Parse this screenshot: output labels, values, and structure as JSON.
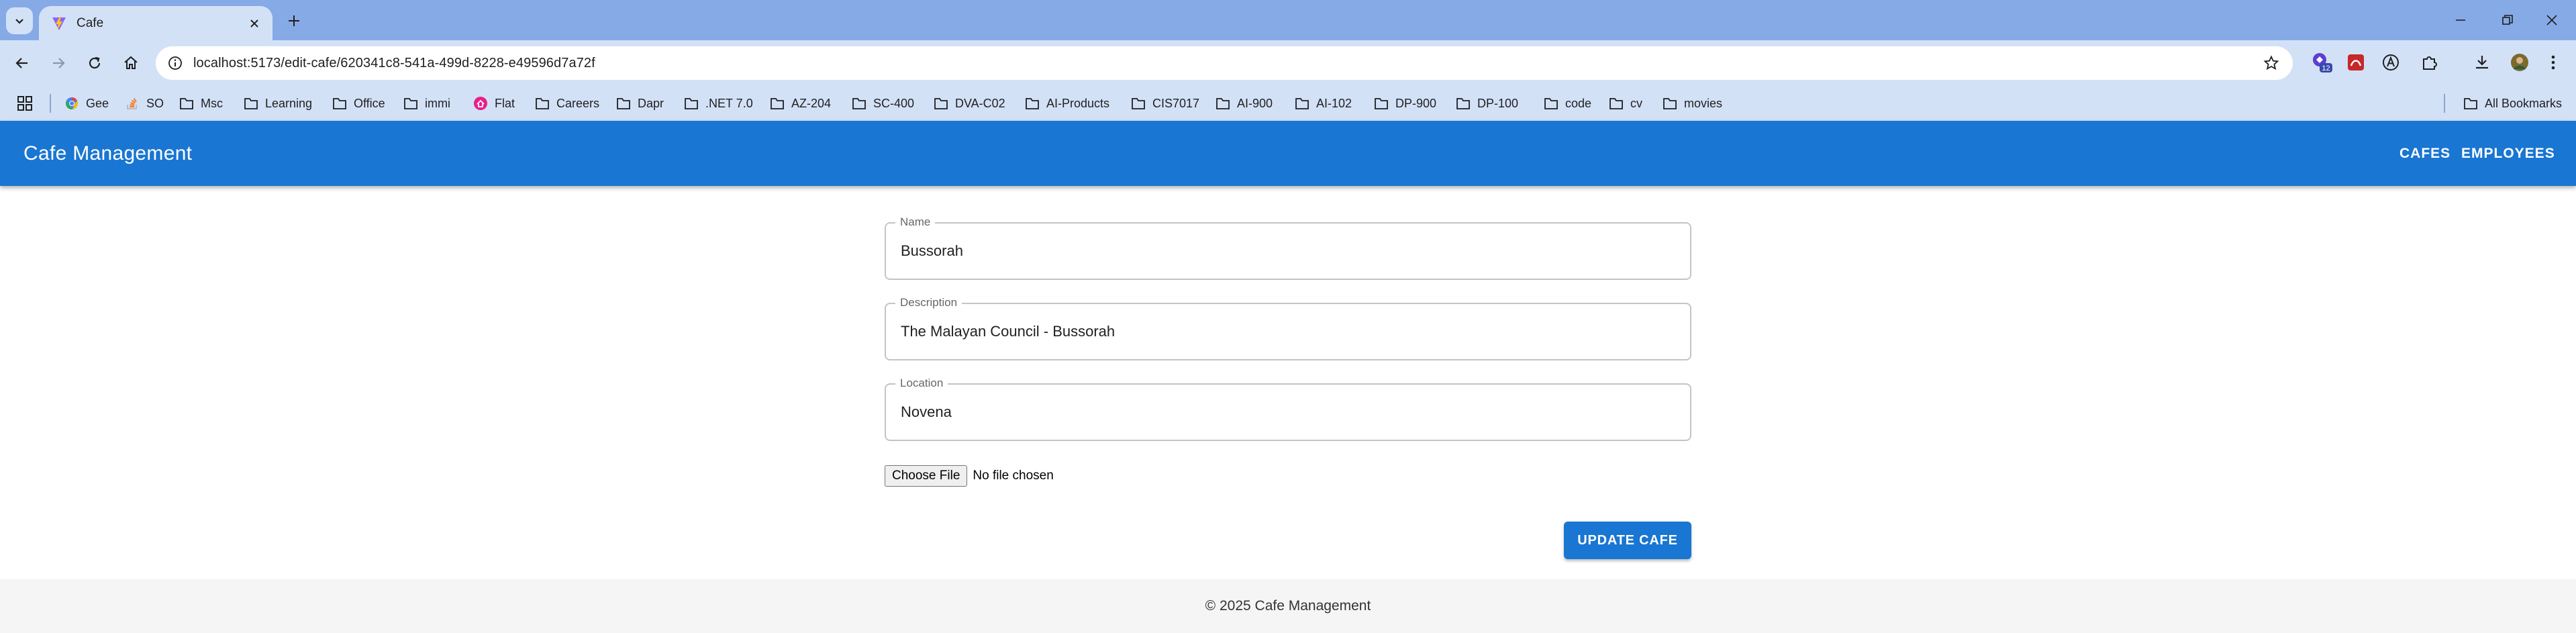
{
  "browser": {
    "tab_title": "Cafe",
    "url": "localhost:5173/edit-cafe/620341c8-541a-499d-8228-e49596d7a72f",
    "extension_badge": "12",
    "bookmarks": [
      {
        "label": "Gee",
        "icon": "chrome-icon"
      },
      {
        "label": "SO",
        "icon": "stackoverflow-icon"
      },
      {
        "label": "Msc",
        "icon": "folder-icon"
      },
      {
        "label": "Learning",
        "icon": "folder-icon"
      },
      {
        "label": "Office",
        "icon": "folder-icon"
      },
      {
        "label": "immi",
        "icon": "folder-icon"
      },
      {
        "label": "Flat",
        "icon": "flat-icon"
      },
      {
        "label": "Careers",
        "icon": "folder-icon"
      },
      {
        "label": "Dapr",
        "icon": "folder-icon"
      },
      {
        "label": ".NET 7.0",
        "icon": "folder-icon"
      },
      {
        "label": "AZ-204",
        "icon": "folder-icon"
      },
      {
        "label": "SC-400",
        "icon": "folder-icon"
      },
      {
        "label": "DVA-C02",
        "icon": "folder-icon"
      },
      {
        "label": "AI-Products",
        "icon": "folder-icon"
      },
      {
        "label": "CIS7017",
        "icon": "folder-icon"
      },
      {
        "label": "AI-900",
        "icon": "folder-icon"
      },
      {
        "label": "AI-102",
        "icon": "folder-icon"
      },
      {
        "label": "DP-900",
        "icon": "folder-icon"
      },
      {
        "label": "DP-100",
        "icon": "folder-icon"
      },
      {
        "label": "code",
        "icon": "folder-icon"
      },
      {
        "label": "cv",
        "icon": "folder-icon"
      },
      {
        "label": "movies",
        "icon": "folder-icon"
      }
    ],
    "all_bookmarks": "All Bookmarks"
  },
  "app": {
    "title": "Cafe Management",
    "nav": {
      "cafes": "CAFES",
      "employees": "EMPLOYEES"
    },
    "primary_color": "#1976d2"
  },
  "form": {
    "name_label": "Name",
    "name_value": "Bussorah",
    "description_label": "Description",
    "description_value": "The Malayan Council - Bussorah",
    "location_label": "Location",
    "location_value": "Novena",
    "file_button": "Choose File",
    "file_status": "No file chosen",
    "submit": "UPDATE CAFE"
  },
  "footer": {
    "text": "© 2025 Cafe Management"
  }
}
